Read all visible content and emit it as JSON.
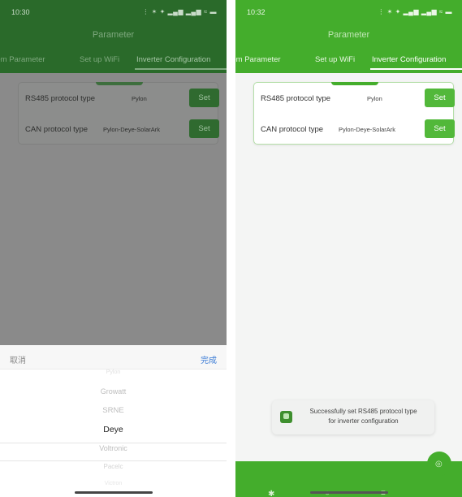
{
  "left_screen": {
    "status_time": "10:30",
    "status_icons": "⋮ ✶ ✦ ▂▄▆ ▂▄▆ ≈ ▬",
    "title": "Parameter",
    "tabs": [
      {
        "label": "stem Parameter",
        "active": false
      },
      {
        "label": "Set up WiFi",
        "active": false
      },
      {
        "label": "Inverter Configuration",
        "active": true
      }
    ],
    "rows": [
      {
        "label": "RS485 protocol type",
        "value": "Pylon",
        "button": "Set"
      },
      {
        "label": "CAN protocol type",
        "value": "Pylon-Deye-SolarArk",
        "button": "Set"
      }
    ],
    "picker": {
      "cancel": "取消",
      "done": "完成",
      "options": [
        "Pylon",
        "Growatt",
        "SRNE",
        "Deye",
        "Voltronic",
        "Pacelc",
        "Victron"
      ],
      "selected": "Deye"
    }
  },
  "right_screen": {
    "status_time": "10:32",
    "status_icons": "⋮ ✶ ✦ ▂▄▆ ▂▄▆ ≈ ▬",
    "title": "Parameter",
    "tabs": [
      {
        "label": "stem Parameter",
        "active": false
      },
      {
        "label": "Set up WiFi",
        "active": false
      },
      {
        "label": "Inverter Configuration",
        "active": true
      }
    ],
    "rows": [
      {
        "label": "RS485 protocol type",
        "value": "Pylon",
        "button": "Set"
      },
      {
        "label": "CAN protocol type",
        "value": "Pylon-Deye-SolarArk",
        "button": "Set"
      }
    ],
    "toast": {
      "line1": "Successfully set RS485 protocol type",
      "line2": "for inverter configuration",
      "icon": "app-check-icon"
    },
    "bottom_nav": [
      {
        "icon": "bluetooth-icon",
        "glyph": "✱"
      },
      {
        "icon": "ring-icon",
        "glyph": "○"
      },
      {
        "icon": "list-icon",
        "glyph": "≡"
      },
      {
        "icon": "settings-icon",
        "glyph": "◎"
      }
    ]
  },
  "colors": {
    "brand_green": "#44ad2c",
    "dim_green": "#2a6a2a",
    "picker_done": "#3a7bd5"
  }
}
